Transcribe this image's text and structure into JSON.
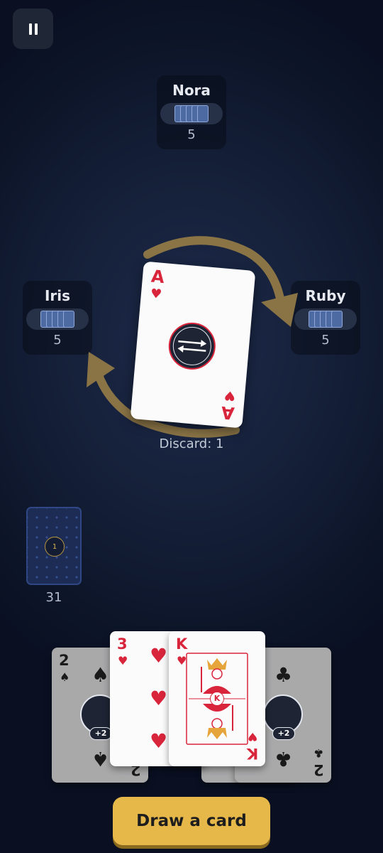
{
  "pause_icon": "pause-icon",
  "opponents": [
    {
      "name": "Nora",
      "count": "5"
    },
    {
      "name": "Iris",
      "count": "5"
    },
    {
      "name": "Ruby",
      "count": "5"
    }
  ],
  "discard": {
    "rank": "A",
    "suit": "♥",
    "action_icon": "swap-direction-icon",
    "label": "Discard: 1"
  },
  "deck": {
    "emblem": "1",
    "count": "31"
  },
  "hand": [
    {
      "rank": "2",
      "suit": "♠",
      "badge": "+2",
      "color": "black"
    },
    {
      "rank": "2",
      "suit": "♣",
      "badge": "+2",
      "color": "black"
    },
    {
      "rank": "3",
      "suit": "♥",
      "color": "red"
    },
    {
      "rank": "K",
      "suit": "♥",
      "color": "red",
      "figure_label": "K"
    }
  ],
  "draw_button": "Draw a card",
  "colors": {
    "accent": "#e6b84a",
    "red_suit": "#d9253b",
    "arrow": "#8a7446"
  }
}
